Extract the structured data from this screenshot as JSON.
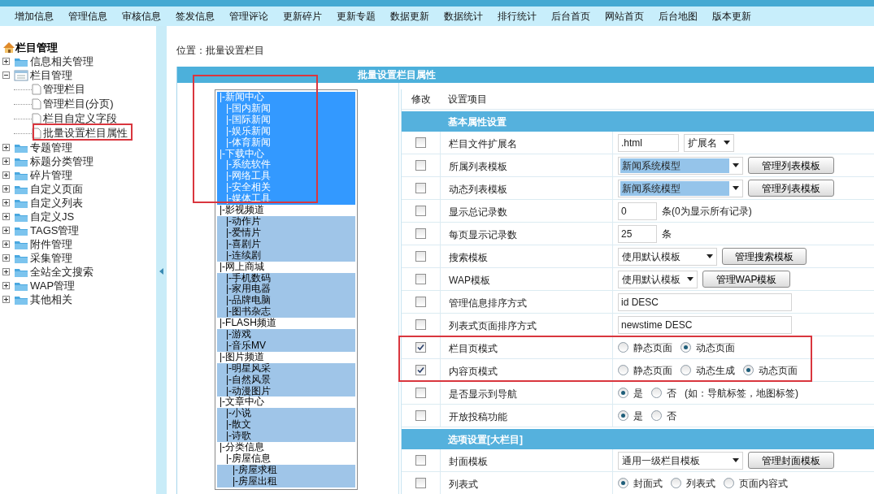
{
  "nav": [
    "增加信息",
    "管理信息",
    "审核信息",
    "签发信息",
    "管理评论",
    "更新碎片",
    "更新专题",
    "数据更新",
    "数据统计",
    "排行统计",
    "后台首页",
    "网站首页",
    "后台地图",
    "版本更新"
  ],
  "sidebar": {
    "title": "栏目管理",
    "items": [
      {
        "label": "信息相关管理",
        "expanded": false
      },
      {
        "label": "栏目管理",
        "expanded": true,
        "children": [
          {
            "label": "管理栏目"
          },
          {
            "label": "管理栏目(分页)"
          },
          {
            "label": "栏目自定义字段"
          },
          {
            "label": "批量设置栏目属性"
          }
        ]
      },
      {
        "label": "专题管理",
        "expanded": false
      },
      {
        "label": "标题分类管理",
        "expanded": false
      },
      {
        "label": "碎片管理",
        "expanded": false
      },
      {
        "label": "自定义页面",
        "expanded": false
      },
      {
        "label": "自定义列表",
        "expanded": false
      },
      {
        "label": "自定义JS",
        "expanded": false
      },
      {
        "label": "TAGS管理",
        "expanded": false
      },
      {
        "label": "附件管理",
        "expanded": false
      },
      {
        "label": "采集管理",
        "expanded": false
      },
      {
        "label": "全站全文搜索",
        "expanded": false
      },
      {
        "label": "WAP管理",
        "expanded": false
      },
      {
        "label": "其他相关",
        "expanded": false
      }
    ]
  },
  "location": "位置：批量设置栏目",
  "panel_title": "批量设置栏目属性",
  "category_list": [
    {
      "label": "|-新闻中心",
      "selected": true,
      "children": [
        {
          "label": "|-国内新闻",
          "selected": true
        },
        {
          "label": "|-国际新闻",
          "selected": true
        },
        {
          "label": "|-娱乐新闻",
          "selected": true
        },
        {
          "label": "|-体育新闻",
          "selected": true
        }
      ]
    },
    {
      "label": "|-下载中心",
      "selected": true,
      "children": [
        {
          "label": "|-系统软件",
          "selected": true
        },
        {
          "label": "|-网络工具",
          "selected": true
        },
        {
          "label": "|-安全相关",
          "selected": true
        },
        {
          "label": "|-媒体工具",
          "selected": true
        }
      ]
    },
    {
      "label": "|-影视频道",
      "selected": false,
      "children": [
        {
          "label": "|-动作片",
          "selected": false
        },
        {
          "label": "|-爱情片",
          "selected": false
        },
        {
          "label": "|-喜剧片",
          "selected": false
        },
        {
          "label": "|-连续剧",
          "selected": false
        }
      ]
    },
    {
      "label": "|-网上商城",
      "selected": false,
      "children": [
        {
          "label": "|-手机数码",
          "selected": false
        },
        {
          "label": "|-家用电器",
          "selected": false
        },
        {
          "label": "|-品牌电脑",
          "selected": false
        },
        {
          "label": "|-图书杂志",
          "selected": false
        }
      ]
    },
    {
      "label": "|-FLASH频道",
      "selected": false,
      "children": [
        {
          "label": "|-游戏",
          "selected": false
        },
        {
          "label": "|-音乐MV",
          "selected": false
        }
      ]
    },
    {
      "label": "|-图片频道",
      "selected": false,
      "children": [
        {
          "label": "|-明星风采",
          "selected": false
        },
        {
          "label": "|-自然风景",
          "selected": false
        },
        {
          "label": "|-动漫图片",
          "selected": false
        }
      ]
    },
    {
      "label": "|-文章中心",
      "selected": false,
      "children": [
        {
          "label": "|-小说",
          "selected": false
        },
        {
          "label": "|-散文",
          "selected": false
        },
        {
          "label": "|-诗歌",
          "selected": false
        }
      ]
    },
    {
      "label": "|-分类信息",
      "selected": false,
      "children": [
        {
          "label": "|-房屋信息",
          "selected": false,
          "children": [
            {
              "label": "|-房屋求租",
              "selected": false
            },
            {
              "label": "|-房屋出租",
              "selected": false
            }
          ]
        }
      ]
    }
  ],
  "columns": [
    "修改",
    "设置项目"
  ],
  "sections": [
    {
      "title": "基本属性设置",
      "rows": [
        {
          "label": "栏目文件扩展名",
          "checked": false,
          "controls": [
            {
              "kind": "input",
              "value": ".html"
            },
            {
              "kind": "select",
              "value": "扩展名",
              "highlighted": false
            }
          ]
        },
        {
          "label": "所属列表模板",
          "checked": false,
          "controls": [
            {
              "kind": "select",
              "value": "新闻系统模型",
              "highlighted": true
            },
            {
              "kind": "button",
              "label": "管理列表模板"
            }
          ]
        },
        {
          "label": "动态列表模板",
          "checked": false,
          "controls": [
            {
              "kind": "select",
              "value": "新闻系统模型",
              "highlighted": true
            },
            {
              "kind": "button",
              "label": "管理列表模板"
            }
          ]
        },
        {
          "label": "显示总记录数",
          "checked": false,
          "controls": [
            {
              "kind": "input",
              "value": "0"
            },
            {
              "kind": "note",
              "text": "条(0为显示所有记录)"
            }
          ]
        },
        {
          "label": "每页显示记录数",
          "checked": false,
          "controls": [
            {
              "kind": "input",
              "value": "25"
            },
            {
              "kind": "note",
              "text": "条"
            }
          ]
        },
        {
          "label": "搜索模板",
          "checked": false,
          "controls": [
            {
              "kind": "select",
              "value": "使用默认模板",
              "highlighted": false
            },
            {
              "kind": "button",
              "label": "管理搜索模板"
            }
          ]
        },
        {
          "label": "WAP模板",
          "checked": false,
          "controls": [
            {
              "kind": "select",
              "value": "使用默认模板",
              "highlighted": false
            },
            {
              "kind": "button",
              "label": "管理WAP模板"
            }
          ]
        },
        {
          "label": "管理信息排序方式",
          "checked": false,
          "controls": [
            {
              "kind": "input",
              "value": "id DESC"
            }
          ]
        },
        {
          "label": "列表式页面排序方式",
          "checked": false,
          "controls": [
            {
              "kind": "input",
              "value": "newstime DESC"
            }
          ]
        },
        {
          "label": "栏目页模式",
          "checked": true,
          "controls": [
            {
              "kind": "radio",
              "options": [
                {
                  "label": "静态页面",
                  "selected": false
                },
                {
                  "label": "动态页面",
                  "selected": true
                }
              ]
            }
          ]
        },
        {
          "label": "内容页模式",
          "checked": true,
          "controls": [
            {
              "kind": "radio",
              "options": [
                {
                  "label": "静态页面",
                  "selected": false
                },
                {
                  "label": "动态生成",
                  "selected": false
                },
                {
                  "label": "动态页面",
                  "selected": true
                }
              ]
            }
          ]
        },
        {
          "label": "是否显示到导航",
          "checked": false,
          "controls": [
            {
              "kind": "radio",
              "options": [
                {
                  "label": "是",
                  "selected": true
                },
                {
                  "label": "否",
                  "selected": false
                }
              ]
            },
            {
              "kind": "note",
              "text": "(如：导航标签，地图标签)"
            }
          ]
        },
        {
          "label": "开放投稿功能",
          "checked": false,
          "controls": [
            {
              "kind": "radio",
              "options": [
                {
                  "label": "是",
                  "selected": true
                },
                {
                  "label": "否",
                  "selected": false
                }
              ]
            }
          ]
        }
      ]
    },
    {
      "title": "选项设置[大栏目]",
      "rows": [
        {
          "label": "封面模板",
          "checked": false,
          "controls": [
            {
              "kind": "select",
              "value": "通用一级栏目模板",
              "highlighted": false
            },
            {
              "kind": "button",
              "label": "管理封面模板"
            }
          ]
        },
        {
          "label": "列表式",
          "checked": false,
          "controls": [
            {
              "kind": "radio",
              "options": [
                {
                  "label": "封面式",
                  "selected": true
                },
                {
                  "label": "列表式",
                  "selected": false
                },
                {
                  "label": "页面内容式",
                  "selected": false
                }
              ]
            }
          ]
        }
      ]
    }
  ]
}
